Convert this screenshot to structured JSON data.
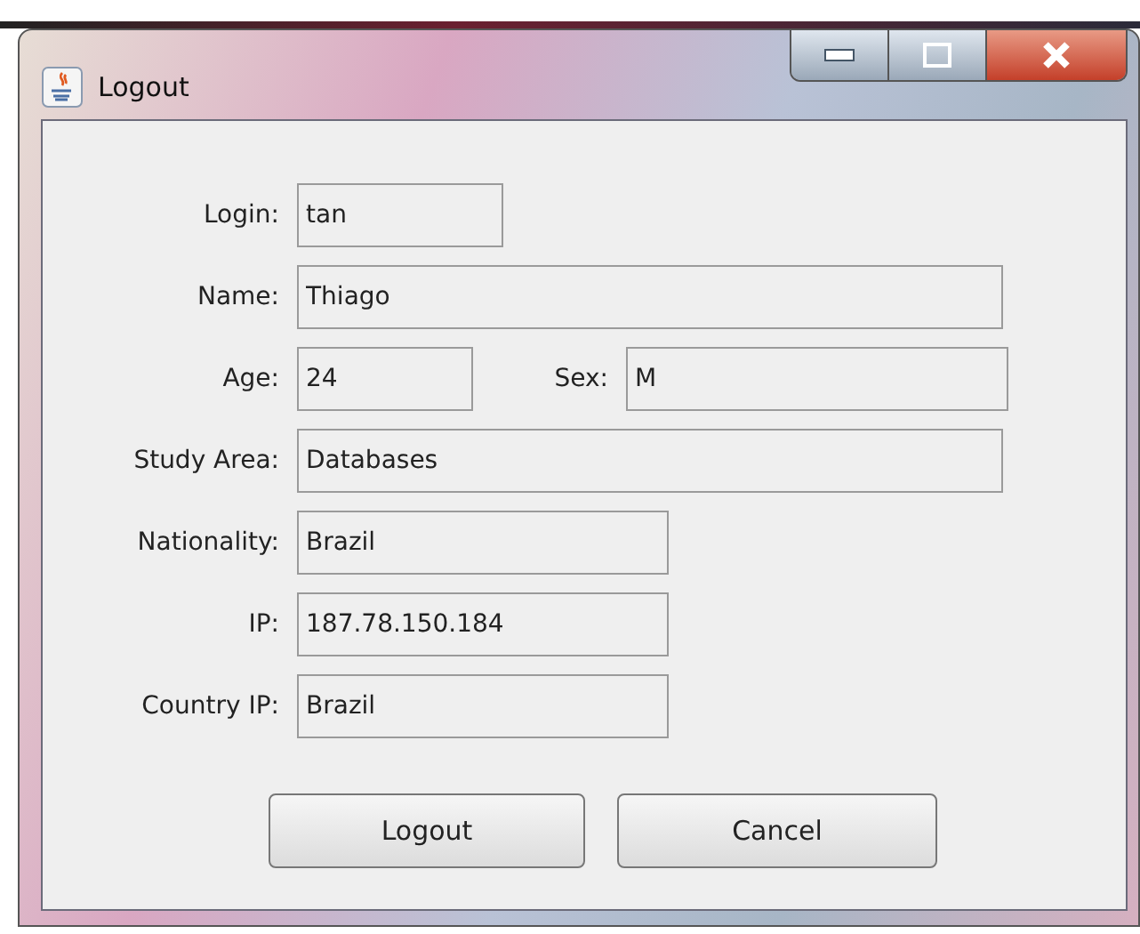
{
  "window": {
    "title": "Logout"
  },
  "form": [
    {
      "fields": [
        {
          "label": "Login:",
          "value": "tan"
        }
      ]
    },
    {
      "fields": [
        {
          "label": "Name:",
          "value": "Thiago"
        }
      ]
    },
    {
      "fields": [
        {
          "label": "Age:",
          "value": "24"
        },
        {
          "label": "Sex:",
          "value": "M"
        }
      ]
    },
    {
      "fields": [
        {
          "label": "Study Area:",
          "value": "Databases"
        }
      ]
    },
    {
      "fields": [
        {
          "label": "Nationality:",
          "value": "Brazil"
        }
      ]
    },
    {
      "fields": [
        {
          "label": "IP:",
          "value": "187.78.150.184"
        }
      ]
    },
    {
      "fields": [
        {
          "label": "Country IP:",
          "value": "Brazil"
        }
      ]
    }
  ],
  "buttons": [
    "Logout",
    "Cancel"
  ]
}
